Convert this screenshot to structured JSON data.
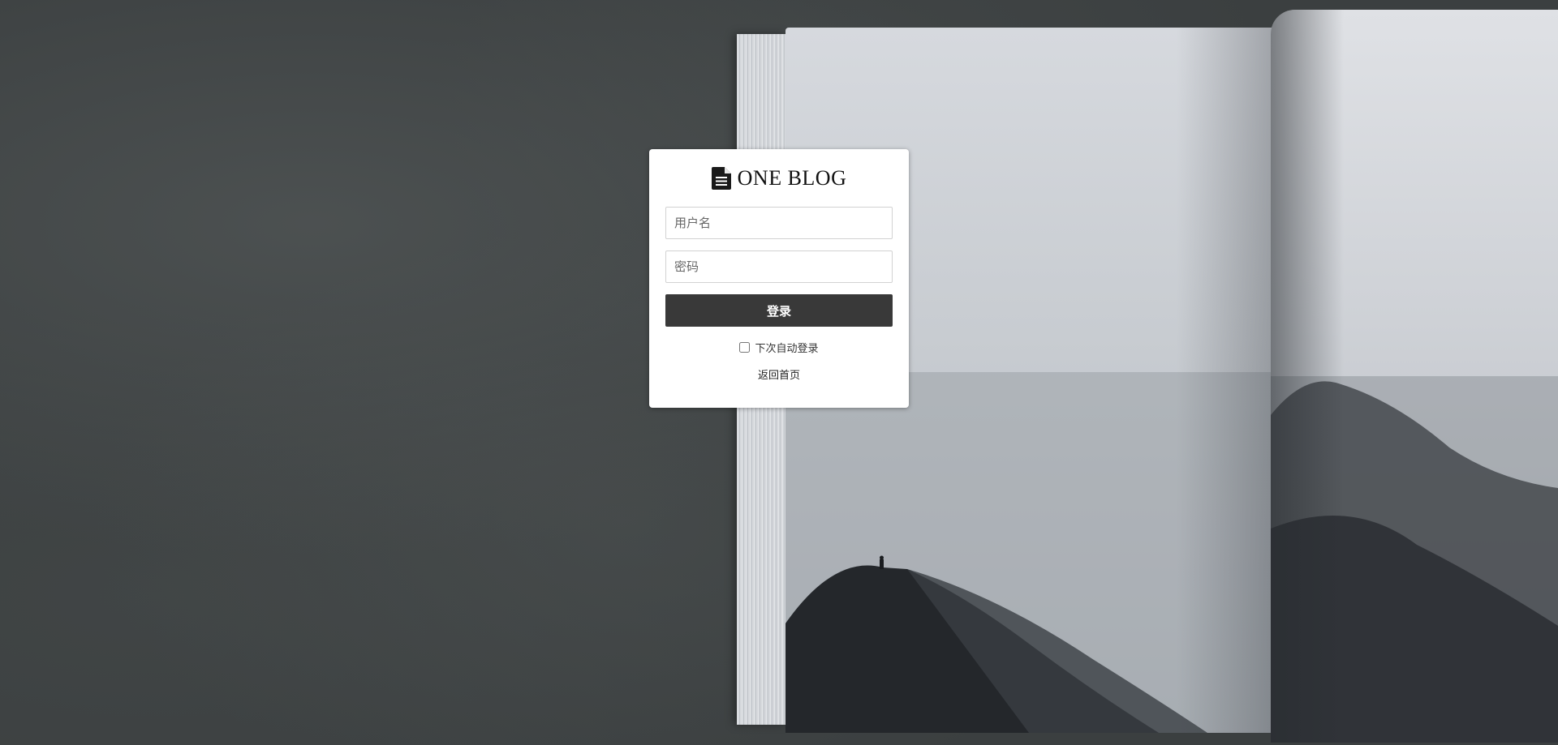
{
  "brand": {
    "name": "ONE BLOG",
    "icon": "document-icon"
  },
  "login_form": {
    "username_placeholder": "用户名",
    "username_value": "",
    "password_placeholder": "密码",
    "password_value": "",
    "login_label": "登录",
    "remember_label": "下次自动登录",
    "remember_checked": false,
    "back_home_label": "返回首页"
  },
  "colors": {
    "button_bg": "#393939",
    "card_bg": "#ffffff",
    "page_bg": "#3b3f40"
  }
}
